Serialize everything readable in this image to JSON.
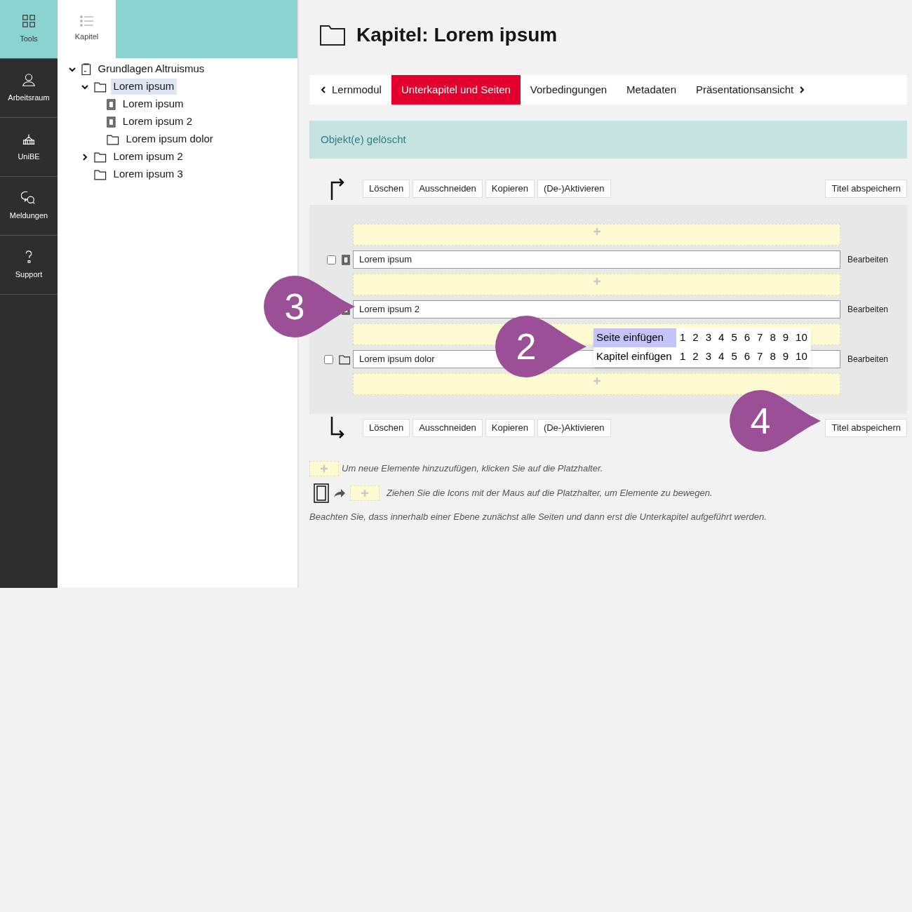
{
  "rail": [
    {
      "label": "Tools",
      "selected": true
    },
    {
      "label": "Arbeitsraum",
      "selected": false
    },
    {
      "label": "UniBE",
      "selected": false
    },
    {
      "label": "Meldungen",
      "selected": false
    },
    {
      "label": "Support",
      "selected": false
    }
  ],
  "panel_tab": {
    "label": "Kapitel",
    "selected": true
  },
  "tree": [
    {
      "label": "Grundlagen Altruismus",
      "kind": "module",
      "expanded": true,
      "selected": false,
      "children": [
        {
          "label": "Lorem ipsum",
          "kind": "chapter",
          "expanded": true,
          "selected": true,
          "children": [
            {
              "label": "Lorem ipsum",
              "kind": "page",
              "selected": false
            },
            {
              "label": "Lorem ipsum 2",
              "kind": "page",
              "selected": false
            },
            {
              "label": "Lorem ipsum dolor",
              "kind": "chapter",
              "selected": false
            }
          ]
        },
        {
          "label": "Lorem ipsum 2",
          "kind": "chapter",
          "expanded": false,
          "selected": false
        },
        {
          "label": "Lorem ipsum 3",
          "kind": "chapter",
          "selected": false
        }
      ]
    }
  ],
  "title": "Kapitel: Lorem ipsum",
  "tabs": [
    {
      "label": "Lernmodul",
      "kind": "back",
      "selected": false
    },
    {
      "label": "Unterkapitel und Seiten",
      "kind": "plain",
      "selected": true
    },
    {
      "label": "Vorbedingungen",
      "kind": "plain",
      "selected": false
    },
    {
      "label": "Metadaten",
      "kind": "plain",
      "selected": false
    },
    {
      "label": "Präsentationsansicht",
      "kind": "forward",
      "selected": false
    }
  ],
  "message": "Objekt(e) gelöscht",
  "toolbar_top": {
    "buttons": [
      "Löschen",
      "Ausschneiden",
      "Kopieren",
      "(De-)Aktivieren"
    ],
    "save": "Titel abspeichern"
  },
  "rows": [
    {
      "title": "Lorem ipsum",
      "kind": "page",
      "checked": false,
      "action": "Bearbeiten"
    },
    {
      "title": "Lorem ipsum 2",
      "kind": "page",
      "action": "Bearbeiten"
    },
    {
      "title": "Lorem ipsum dolor",
      "kind": "chapter",
      "checked": false,
      "action": "Bearbeiten"
    }
  ],
  "toolbar_bottom": {
    "buttons": [
      "Löschen",
      "Ausschneiden",
      "Kopieren",
      "(De-)Aktivieren"
    ],
    "save": "Titel abspeichern"
  },
  "insert_menu": [
    {
      "label": "Seite einfügen",
      "selected": true,
      "options": [
        "1",
        "2",
        "3",
        "4",
        "5",
        "6",
        "7",
        "8",
        "9",
        "10"
      ]
    },
    {
      "label": "Kapitel einfügen",
      "selected": false,
      "options": [
        "1",
        "2",
        "3",
        "4",
        "5",
        "6",
        "7",
        "8",
        "9",
        "10"
      ]
    }
  ],
  "legend": [
    "Um neue Elemente hinzuzufügen, klicken Sie auf die Platzhalter.",
    "Ziehen Sie die Icons mit der Maus auf die Platzhalter, um Elemente zu bewegen.",
    "Beachten Sie, dass innerhalb einer Ebene zunächst alle Seiten und dann erst die Unterkapitel aufgeführt werden."
  ],
  "callouts": [
    "3",
    "2",
    "4"
  ]
}
